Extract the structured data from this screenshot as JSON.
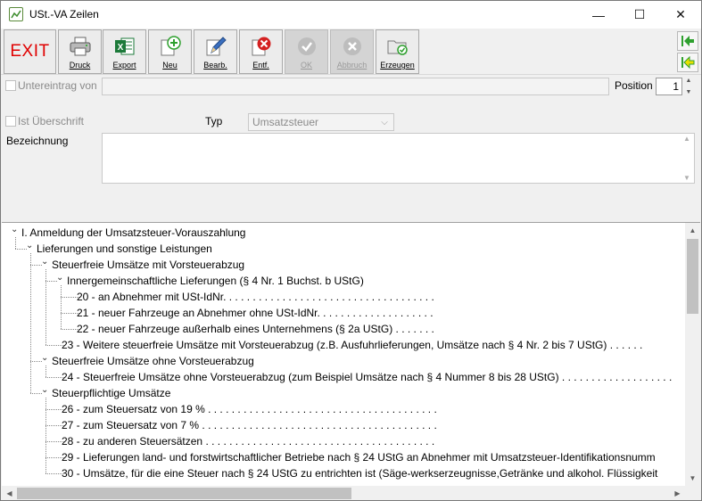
{
  "window": {
    "title": "USt.-VA Zeilen",
    "minimize": "—",
    "maximize": "☐",
    "close": "✕"
  },
  "toolbar": {
    "exit": "EXIT",
    "buttons": [
      {
        "label": "Druck",
        "icon": "printer-icon",
        "enabled": true
      },
      {
        "label": "Export",
        "icon": "excel-icon",
        "enabled": true
      },
      {
        "label": "Neu",
        "icon": "add-icon",
        "enabled": true
      },
      {
        "label": "Bearb.",
        "icon": "edit-pencil-icon",
        "enabled": true
      },
      {
        "label": "Entf.",
        "icon": "delete-icon",
        "enabled": true
      },
      {
        "label": "OK",
        "icon": "check-icon",
        "enabled": false
      },
      {
        "label": "Abbruch",
        "icon": "cancel-icon",
        "enabled": false
      },
      {
        "label": "Erzeugen",
        "icon": "folder-gear-icon",
        "enabled": true
      }
    ]
  },
  "form": {
    "untereintrag_label": "Untereintrag von",
    "position_label": "Position",
    "position_value": "1",
    "ist_ueberschrift_label": "Ist Überschrift",
    "typ_label": "Typ",
    "typ_value": "Umsatzsteuer",
    "bezeichnung_label": "Bezeichnung",
    "bezeichnung_value": ""
  },
  "tree": [
    {
      "text": "I. Anmeldung der Umsatzsteuer-Vorauszahlung",
      "level": 0,
      "expandable": true
    },
    {
      "text": "Lieferungen und sonstige Leistungen",
      "level": 1,
      "expandable": true
    },
    {
      "text": "Steuerfreie Umsätze mit Vorsteuerabzug",
      "level": 2,
      "expandable": true
    },
    {
      "text": "Innergemeinschaftliche Lieferungen (§ 4 Nr. 1 Buchst. b UStG)",
      "level": 3,
      "expandable": true
    },
    {
      "text": "20 - an Abnehmer mit USt-IdNr. . . . . . . . . . . . . . . . . . . . . . . . . . . . . . . . . . . .",
      "level": 4,
      "expandable": false
    },
    {
      "text": "21 - neuer Fahrzeuge an Abnehmer ohne USt-IdNr. . . . . . . . . . . . . . . . . . . .",
      "level": 4,
      "expandable": false
    },
    {
      "text": "22 - neuer Fahrzeuge außerhalb eines Unternehmens (§ 2a UStG) . . . . . . .",
      "level": 4,
      "expandable": false
    },
    {
      "text": "23 - Weitere steuerfreie Umsätze mit Vorsteuerabzug (z.B. Ausfuhrlieferungen, Umsätze nach § 4 Nr. 2 bis 7 UStG) . . . . . .",
      "level": 3,
      "expandable": false
    },
    {
      "text": "Steuerfreie Umsätze ohne Vorsteuerabzug",
      "level": 2,
      "expandable": true
    },
    {
      "text": "24 - Steuerfreie Umsätze ohne Vorsteuerabzug (zum Beispiel Umsätze nach § 4 Nummer 8 bis 28 UStG) . . . . . . . . . . . . . . . . . . .",
      "level": 3,
      "expandable": false
    },
    {
      "text": "Steuerpflichtige Umsätze",
      "level": 2,
      "expandable": true
    },
    {
      "text": "26 - zum Steuersatz von 19 % . . . . . . . . . . . . . . . . . . . . . . . . . . . . . . . . . . . . . . .",
      "level": 3,
      "expandable": false
    },
    {
      "text": "27 - zum Steuersatz von 7 % . . . . . . . . . . . . . . . . . . . . . . . . . . . . . . . . . . . . . . . .",
      "level": 3,
      "expandable": false
    },
    {
      "text": "28 - zu anderen Steuersätzen . . . . . . . . . . . . . . . . . . . . . . . . . . . . . . . . . . . . . . .",
      "level": 3,
      "expandable": false
    },
    {
      "text": "29 - Lieferungen land- und forstwirtschaftlicher Betriebe nach § 24 UStG an Abnehmer mit Umsatzsteuer-Identifikationsnumm",
      "level": 3,
      "expandable": false
    },
    {
      "text": "30 - Umsätze, für die eine Steuer nach § 24 UStG zu entrichten ist (Säge-werkserzeugnisse,Getränke und alkohol. Flüssigkeit",
      "level": 3,
      "expandable": false
    }
  ],
  "colors": {
    "exit_red": "#e00000",
    "nav_green": "#2ea02e",
    "excel_green": "#1d7a3a",
    "delete_red": "#d42020"
  }
}
